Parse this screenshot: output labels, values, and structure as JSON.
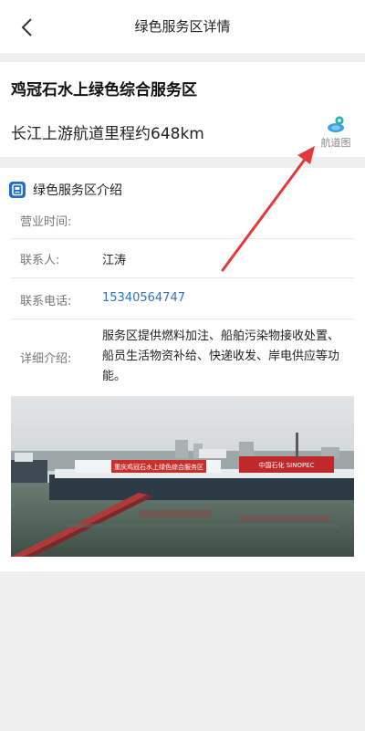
{
  "nav": {
    "title": "绿色服务区详情"
  },
  "station": {
    "name": "鸡冠石水上绿色综合服务区",
    "mileage": "长江上游航道里程约648km",
    "map_label": "航道图"
  },
  "intro": {
    "section_title": "绿色服务区介绍",
    "rows": [
      {
        "label": "营业时间:",
        "value": ""
      },
      {
        "label": "联系人:",
        "value": "江涛"
      },
      {
        "label": "联系电话:",
        "value": "15340564747"
      },
      {
        "label": "详细介绍:",
        "value": "服务区提供燃料加注、船舶污染物接收处置、船员生活物资补给、快递收发、岸电供应等功能。"
      }
    ]
  },
  "photo": {
    "banner_text": "重庆鸡冠石水上绿色综合服务区",
    "sinopec_text": "中国石化 SINOPEC"
  },
  "colors": {
    "phone_link": "#2f72c4",
    "accent_blue": "#1e6fc7",
    "annotation_arrow": "#e03a3a"
  }
}
